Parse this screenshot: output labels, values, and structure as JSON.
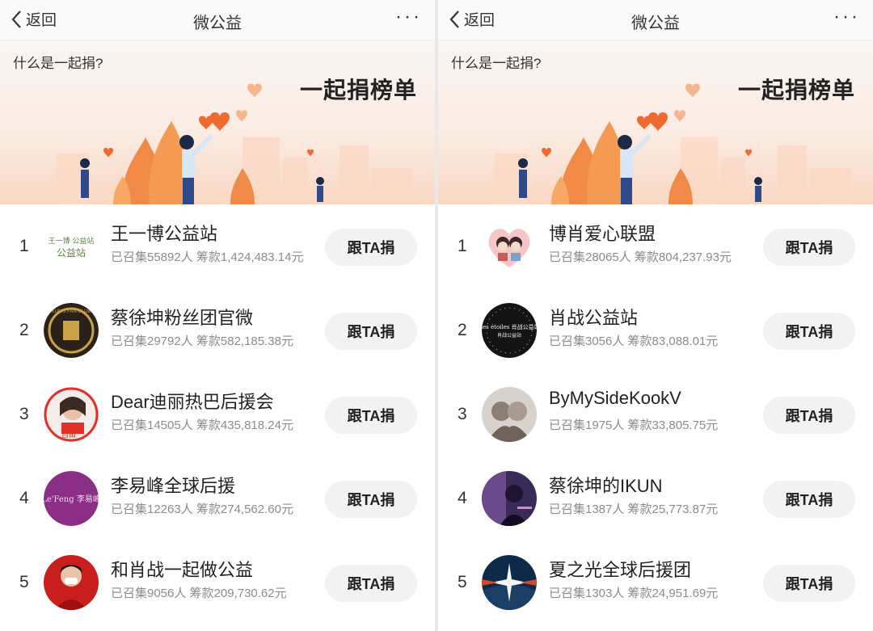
{
  "panels": [
    {
      "nav": {
        "back_label": "返回",
        "title": "微公益",
        "more": "···"
      },
      "banner": {
        "question": "什么是一起捐?",
        "title": "一起捐榜单"
      },
      "rows": [
        {
          "rank": "1",
          "name": "王一博公益站",
          "stats": "已召集55892人 筹款1,424,483.14元",
          "button": "跟TA捐"
        },
        {
          "rank": "2",
          "name": "蔡徐坤粉丝团官微",
          "stats": "已召集29792人 筹款582,185.38元",
          "button": "跟TA捐"
        },
        {
          "rank": "3",
          "name": "Dear迪丽热巴后援会",
          "stats": "已召集14505人 筹款435,818.24元",
          "button": "跟TA捐"
        },
        {
          "rank": "4",
          "name": "李易峰全球后援",
          "stats": "已召集12263人 筹款274,562.60元",
          "button": "跟TA捐"
        },
        {
          "rank": "5",
          "name": "和肖战一起做公益",
          "stats": "已召集9056人 筹款209,730.62元",
          "button": "跟TA捐"
        }
      ]
    },
    {
      "nav": {
        "back_label": "返回",
        "title": "微公益",
        "more": "···"
      },
      "banner": {
        "question": "什么是一起捐?",
        "title": "一起捐榜单"
      },
      "rows": [
        {
          "rank": "1",
          "name": "博肖爱心联盟",
          "stats": "已召集28065人 筹款804,237.93元",
          "button": "跟TA捐"
        },
        {
          "rank": "2",
          "name": "肖战公益站",
          "stats": "已召集3056人 筹款83,088.01元",
          "button": "跟TA捐"
        },
        {
          "rank": "3",
          "name": "ByMySideKookV",
          "stats": "已召集1975人 筹款33,805.75元",
          "button": "跟TA捐"
        },
        {
          "rank": "4",
          "name": "蔡徐坤的IKUN",
          "stats": "已召集1387人 筹款25,773.87元",
          "button": "跟TA捐"
        },
        {
          "rank": "5",
          "name": "夏之光全球后援团",
          "stats": "已召集1303人 筹款24,951.69元",
          "button": "跟TA捐"
        }
      ]
    }
  ],
  "avatar_text": {
    "wang": "王一博 公益站",
    "cai_fans": "KUN'S FAN CLUB",
    "dilireba": "自由",
    "liyifeng": "Le'Feng 李易峰",
    "xiaozhan_station": "Les étoiles 肖战公益站"
  },
  "colors": {
    "accent": "#f07a3c",
    "button_bg": "#f2f2f2",
    "muted_text": "#8c8c8c"
  }
}
